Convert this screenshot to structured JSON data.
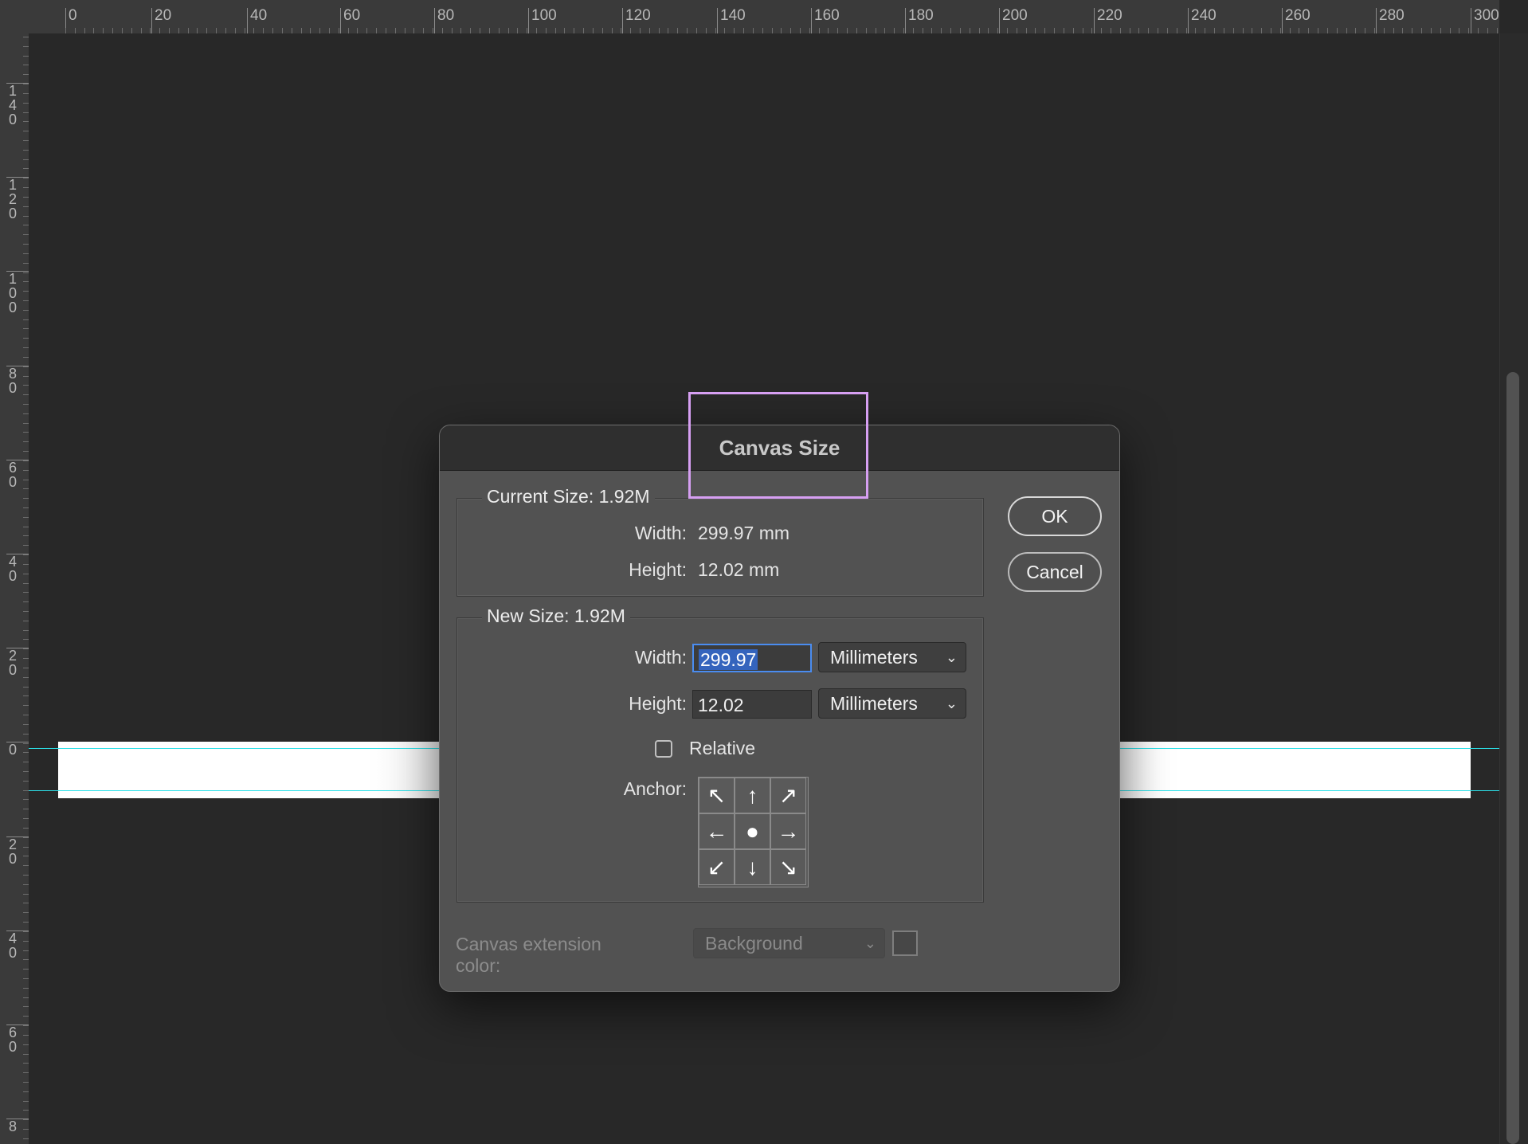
{
  "rulers": {
    "horizontal_labels": [
      "0",
      "20",
      "40",
      "60",
      "80",
      "100",
      "120",
      "140",
      "160",
      "180",
      "200",
      "220",
      "240",
      "260",
      "280",
      "300"
    ],
    "vertical_labels": [
      "140",
      "120",
      "100",
      "80",
      "60",
      "40",
      "20",
      "0",
      "20",
      "40",
      "60",
      "8"
    ]
  },
  "dialog": {
    "title": "Canvas Size",
    "current_size": {
      "title": "Current Size: 1.92M",
      "width_label": "Width:",
      "width_value": "299.97 mm",
      "height_label": "Height:",
      "height_value": "12.02 mm"
    },
    "new_size": {
      "title": "New Size: 1.92M",
      "width_label": "Width:",
      "width_value": "299.97",
      "width_unit": "Millimeters",
      "height_label": "Height:",
      "height_value": "12.02",
      "height_unit": "Millimeters",
      "relative_label": "Relative",
      "relative_checked": false,
      "anchor_label": "Anchor:",
      "anchor_selected": "center"
    },
    "extension_color": {
      "label": "Canvas extension color:",
      "value": "Background",
      "disabled": true
    },
    "buttons": {
      "ok": "OK",
      "cancel": "Cancel"
    }
  },
  "colors": {
    "guide": "#2ce0e8",
    "highlight": "#d69ff2",
    "selection": "#3464bd"
  }
}
